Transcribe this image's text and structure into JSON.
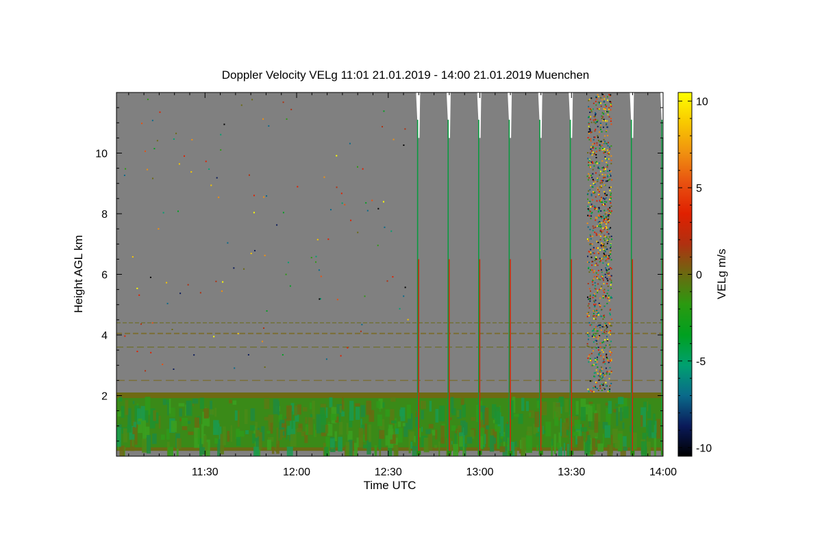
{
  "chart_data": {
    "type": "heatmap",
    "title": "Doppler Velocity VELg   11:01 21.01.2019 - 14:00 21.01.2019 Muenchen",
    "xlabel": "Time UTC",
    "ylabel": "Height AGL km",
    "x_range": [
      "11:01",
      "14:00"
    ],
    "x_ticks": [
      "11:30",
      "12:00",
      "12:30",
      "13:00",
      "13:30",
      "14:00"
    ],
    "ylim": [
      0,
      12
    ],
    "y_ticks": [
      2,
      4,
      6,
      8,
      10
    ],
    "colorbar": {
      "label": "VELg m/s",
      "range": [
        -10.5,
        10.5
      ],
      "ticks": [
        10,
        5,
        0,
        -5,
        -10
      ],
      "colors": [
        "#000000",
        "#0a1a5a",
        "#0a6a8a",
        "#00a070",
        "#00a020",
        "#2a9a10",
        "#6a6a10",
        "#b03010",
        "#e02000",
        "#e85010",
        "#f09010",
        "#f8c800",
        "#ffff00"
      ]
    },
    "no_signal_color": "#808080",
    "boundary_layer": {
      "top_km": 2.1,
      "base_km": 0.2,
      "description_values_ms": [
        -2,
        0
      ]
    },
    "aerosol_layers_km": [
      4.4,
      4.05,
      3.6,
      2.5
    ],
    "vertical_scan_times": [
      "12:40",
      "12:50",
      "13:00",
      "13:10",
      "13:20",
      "13:30",
      "13:50",
      "14:00"
    ],
    "noisy_period": [
      "13:35",
      "13:43"
    ]
  }
}
